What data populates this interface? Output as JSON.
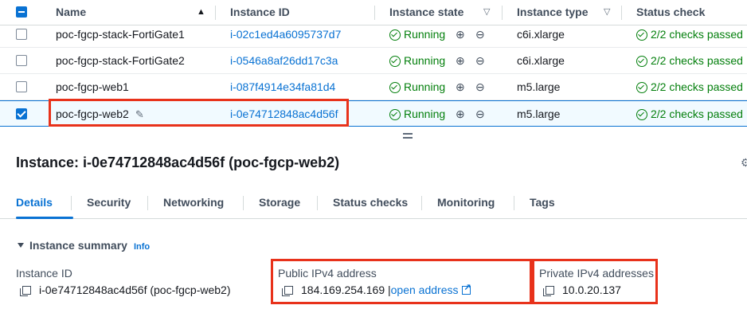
{
  "table": {
    "headers": {
      "name": "Name",
      "instance_id": "Instance ID",
      "instance_state": "Instance state",
      "instance_type": "Instance type",
      "status_check": "Status check"
    },
    "rows": [
      {
        "name": "poc-fgcp-stack-FortiGate1",
        "instance_id": "i-02c1ed4a6095737d7",
        "state": "Running",
        "type": "c6i.xlarge",
        "status": "2/2 checks passed",
        "selected": false
      },
      {
        "name": "poc-fgcp-stack-FortiGate2",
        "instance_id": "i-0546a8af26dd17c3a",
        "state": "Running",
        "type": "c6i.xlarge",
        "status": "2/2 checks passed",
        "selected": false
      },
      {
        "name": "poc-fgcp-web1",
        "instance_id": "i-087f4914e34fa81d4",
        "state": "Running",
        "type": "m5.large",
        "status": "2/2 checks passed",
        "selected": false
      },
      {
        "name": "poc-fgcp-web2",
        "instance_id": "i-0e74712848ac4d56f",
        "state": "Running",
        "type": "m5.large",
        "status": "2/2 checks passed",
        "selected": true
      }
    ]
  },
  "details": {
    "title": "Instance: i-0e74712848ac4d56f (poc-fgcp-web2)",
    "tabs": [
      "Details",
      "Security",
      "Networking",
      "Storage",
      "Status checks",
      "Monitoring",
      "Tags"
    ],
    "active_tab": "Details",
    "summary": {
      "heading": "Instance summary",
      "info": "Info",
      "instance_id_label": "Instance ID",
      "instance_id_value": "i-0e74712848ac4d56f (poc-fgcp-web2)",
      "public_ipv4_label": "Public IPv4 address",
      "public_ipv4_value": "184.169.254.169",
      "open_address": "open address",
      "private_ipv4_label": "Private IPv4 addresses",
      "private_ipv4_value": "10.0.20.137"
    }
  },
  "colors": {
    "link": "#0972d3",
    "success": "#037f0c",
    "highlight": "#e8321b"
  }
}
